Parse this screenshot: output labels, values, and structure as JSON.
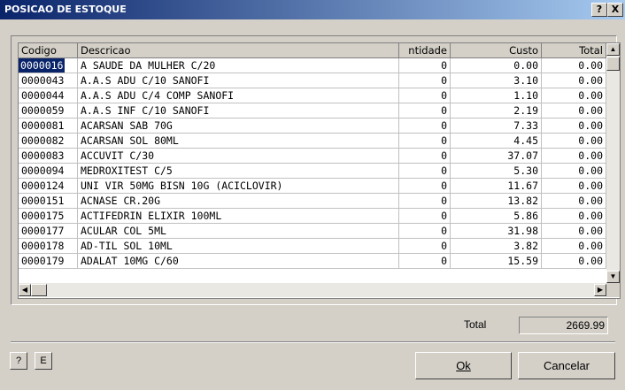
{
  "window": {
    "title": "POSICAO DE ESTOQUE",
    "help_btn": "?",
    "close_btn": "X"
  },
  "grid": {
    "columns": [
      "Codigo",
      "Descricao",
      "ntidade",
      "Custo",
      "Total"
    ],
    "rows": [
      [
        "0000016",
        "A SAUDE DA MULHER C/20",
        "0",
        "0.00",
        "0.00"
      ],
      [
        "0000043",
        "A.A.S ADU C/10 SANOFI",
        "0",
        "3.10",
        "0.00"
      ],
      [
        "0000044",
        "A.A.S ADU C/4 COMP SANOFI",
        "0",
        "1.10",
        "0.00"
      ],
      [
        "0000059",
        "A.A.S INF C/10 SANOFI",
        "0",
        "2.19",
        "0.00"
      ],
      [
        "0000081",
        "ACARSAN SAB 70G",
        "0",
        "7.33",
        "0.00"
      ],
      [
        "0000082",
        "ACARSAN SOL 80ML",
        "0",
        "4.45",
        "0.00"
      ],
      [
        "0000083",
        "ACCUVIT C/30",
        "0",
        "37.07",
        "0.00"
      ],
      [
        "0000094",
        "MEDROXITEST C/5",
        "0",
        "5.30",
        "0.00"
      ],
      [
        "0000124",
        "UNI VIR 50MG BISN 10G (ACICLOVIR)",
        "0",
        "11.67",
        "0.00"
      ],
      [
        "0000151",
        "ACNASE CR.20G",
        "0",
        "13.82",
        "0.00"
      ],
      [
        "0000175",
        "ACTIFEDRIN ELIXIR 100ML",
        "0",
        "5.86",
        "0.00"
      ],
      [
        "0000177",
        "ACULAR COL 5ML",
        "0",
        "31.98",
        "0.00"
      ],
      [
        "0000178",
        "AD-TIL SOL 10ML",
        "0",
        "3.82",
        "0.00"
      ],
      [
        "0000179",
        "ADALAT 10MG C/60",
        "0",
        "15.59",
        "0.00"
      ]
    ],
    "selected_row": 0
  },
  "total": {
    "label": "Total",
    "value": "2669.99"
  },
  "buttons": {
    "help": "?",
    "export": "E",
    "ok": "Ok",
    "cancel": "Cancelar"
  }
}
